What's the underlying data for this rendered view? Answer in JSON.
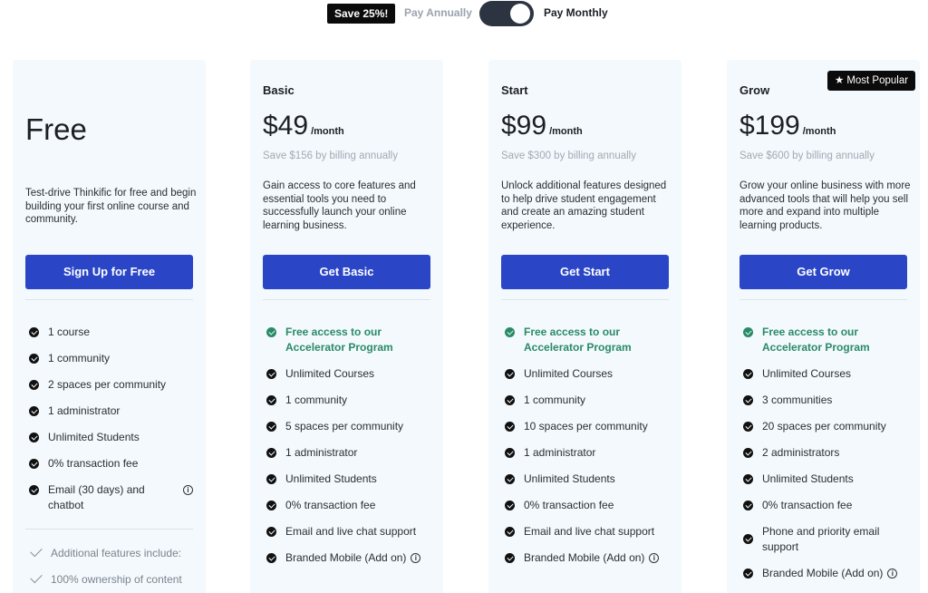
{
  "billing": {
    "save_badge": "Save 25%!",
    "annually_label": "Pay Annually",
    "monthly_label": "Pay Monthly"
  },
  "popular_badge": {
    "star": "★",
    "label": "Most Popular"
  },
  "plans": [
    {
      "name": "",
      "title": "Free",
      "description": "Test-drive Thinkific for free and begin building your first online course and community.",
      "cta": "Sign Up for Free",
      "features": [
        "1 course",
        "1 community",
        "2 spaces per community",
        "1 administrator",
        "Unlimited Students",
        "0% transaction fee",
        "Email (30 days) and chatbot"
      ],
      "extra": [
        "Additional features include:",
        "100% ownership of content"
      ]
    },
    {
      "name": "Basic",
      "price": "$49",
      "per": "/month",
      "saving": "Save $156 by billing annually",
      "description": "Gain access to core features and essential tools you need to successfully launch your online learning business.",
      "cta": "Get Basic",
      "accent_feature": "Free access to our Accelerator Program",
      "features": [
        "Unlimited Courses",
        "1 community",
        "5 spaces per community",
        "1 administrator",
        "Unlimited Students",
        "0% transaction fee",
        "Email and live chat support",
        "Branded Mobile (Add on)"
      ]
    },
    {
      "name": "Start",
      "price": "$99",
      "per": "/month",
      "saving": "Save $300 by billing annually",
      "description": "Unlock additional features designed to help drive student engagement and create an amazing student experience.",
      "cta": "Get Start",
      "accent_feature": "Free access to our Accelerator Program",
      "features": [
        "Unlimited Courses",
        "1 community",
        "10 spaces per community",
        "1 administrator",
        "Unlimited Students",
        "0% transaction fee",
        "Email and live chat support",
        "Branded Mobile (Add on)"
      ]
    },
    {
      "name": "Grow",
      "price": "$199",
      "per": "/month",
      "saving": "Save $600 by billing annually",
      "description": "Grow your online business with more advanced tools that will help you sell more and expand into multiple learning products.",
      "cta": "Get Grow",
      "accent_feature": "Free access to our Accelerator Program",
      "features": [
        "Unlimited Courses",
        "3 communities",
        "20 spaces per community",
        "2 administrators",
        "Unlimited Students",
        "0% transaction fee",
        "Phone and priority email support",
        "Branded Mobile (Add on)"
      ]
    }
  ],
  "info_glyph": "i",
  "colors": {
    "accent_blue": "#2a46c6",
    "accent_green": "#2a8a66",
    "card_bg": "#f3f9fd"
  }
}
